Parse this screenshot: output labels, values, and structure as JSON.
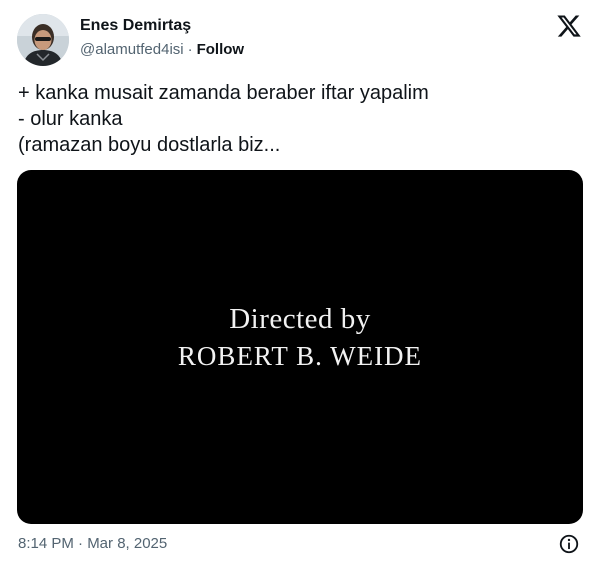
{
  "author": {
    "name": "Enes Demirtaş",
    "handle": "@alamutfed4isi",
    "separator": "·",
    "follow_label": "Follow",
    "avatar_icon": "profile-photo"
  },
  "brand_icon": "x-logo-icon",
  "tweet": {
    "lines": [
      "+ kanka musait zamanda beraber iftar yapalim",
      "- olur kanka",
      "(ramazan boyu dostlarla biz..."
    ]
  },
  "media": {
    "line1": "Directed by",
    "line2": "ROBERT B. WEIDE",
    "background": "#000000"
  },
  "footer": {
    "timestamp": "8:14 PM · Mar 8, 2025",
    "info_icon": "info-icon"
  },
  "colors": {
    "text_primary": "#0f1419",
    "text_secondary": "#536471"
  }
}
